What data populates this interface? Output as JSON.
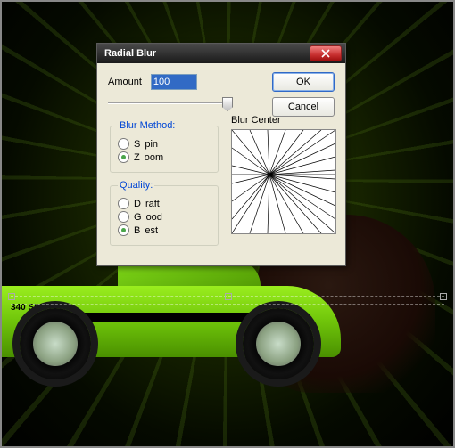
{
  "dialog": {
    "title": "Radial Blur",
    "amount_label": "Amount",
    "amount_value": "100",
    "ok_label": "OK",
    "cancel_label": "Cancel",
    "blur_method": {
      "legend": "Blur Method:",
      "options": [
        {
          "label": "Spin",
          "checked": false
        },
        {
          "label": "Zoom",
          "checked": true
        }
      ]
    },
    "quality": {
      "legend": "Quality:",
      "options": [
        {
          "label": "Draft",
          "checked": false
        },
        {
          "label": "Good",
          "checked": false
        },
        {
          "label": "Best",
          "checked": true
        }
      ]
    },
    "blur_center_label": "Blur Center"
  },
  "car_badge": "340 SIX"
}
